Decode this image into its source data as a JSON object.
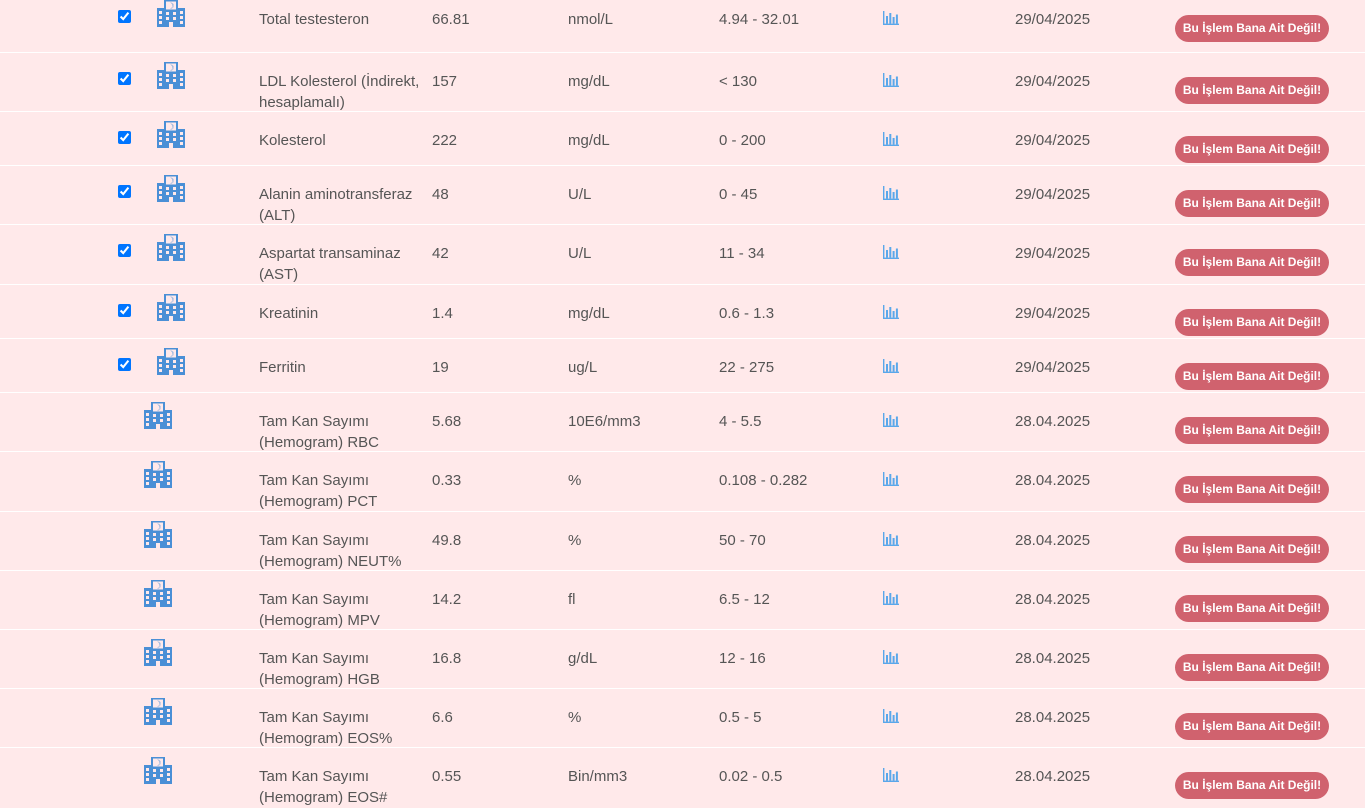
{
  "colors": {
    "row_background": "#ffe9ea",
    "row_divider": "#ffffff",
    "button_background": "#d0626e",
    "button_text": "#ffffff",
    "icon_blue": "#4a8fd6",
    "chart_icon_blue": "#5aa7ea"
  },
  "icons": {
    "checkbox": "checked-checkbox",
    "facility": "hospital-building-icon",
    "chart": "bar-chart-icon"
  },
  "results": [
    {
      "checked": true,
      "name": "Total testesteron",
      "value": "66.81",
      "unit": "nmol/L",
      "reference": "4.94 - 32.01",
      "date": "29/04/2025",
      "action_label": "Bu İşlem Bana Ait Değil!"
    },
    {
      "checked": true,
      "name": "LDL Kolesterol (İndirekt, hesaplamalı)",
      "value": "157",
      "unit": "mg/dL",
      "reference": "< 130",
      "date": "29/04/2025",
      "action_label": "Bu İşlem Bana Ait Değil!"
    },
    {
      "checked": true,
      "name": "Kolesterol",
      "value": "222",
      "unit": "mg/dL",
      "reference": "0 - 200",
      "date": "29/04/2025",
      "action_label": "Bu İşlem Bana Ait Değil!"
    },
    {
      "checked": true,
      "name": "Alanin aminotransferaz (ALT)",
      "value": "48",
      "unit": "U/L",
      "reference": "0 - 45",
      "date": "29/04/2025",
      "action_label": "Bu İşlem Bana Ait Değil!"
    },
    {
      "checked": true,
      "name": "Aspartat transaminaz (AST)",
      "value": "42",
      "unit": "U/L",
      "reference": "11 - 34",
      "date": "29/04/2025",
      "action_label": "Bu İşlem Bana Ait Değil!"
    },
    {
      "checked": true,
      "name": "Kreatinin",
      "value": "1.4",
      "unit": "mg/dL",
      "reference": "0.6 - 1.3",
      "date": "29/04/2025",
      "action_label": "Bu İşlem Bana Ait Değil!"
    },
    {
      "checked": true,
      "name": "Ferritin",
      "value": "19",
      "unit": "ug/L",
      "reference": "22 - 275",
      "date": "29/04/2025",
      "action_label": "Bu İşlem Bana Ait Değil!"
    },
    {
      "checked": false,
      "name": "Tam Kan Sayımı (Hemogram) RBC",
      "value": "5.68",
      "unit": "10E6/mm3",
      "reference": "4 - 5.5",
      "date": "28.04.2025",
      "action_label": "Bu İşlem Bana Ait Değil!"
    },
    {
      "checked": false,
      "name": "Tam Kan Sayımı (Hemogram) PCT",
      "value": "0.33",
      "unit": "%",
      "reference": "0.108 - 0.282",
      "date": "28.04.2025",
      "action_label": "Bu İşlem Bana Ait Değil!"
    },
    {
      "checked": false,
      "name": "Tam Kan Sayımı (Hemogram) NEUT%",
      "value": "49.8",
      "unit": "%",
      "reference": "50 - 70",
      "date": "28.04.2025",
      "action_label": "Bu İşlem Bana Ait Değil!"
    },
    {
      "checked": false,
      "name": "Tam Kan Sayımı (Hemogram) MPV",
      "value": "14.2",
      "unit": "fl",
      "reference": "6.5 - 12",
      "date": "28.04.2025",
      "action_label": "Bu İşlem Bana Ait Değil!"
    },
    {
      "checked": false,
      "name": "Tam Kan Sayımı (Hemogram) HGB",
      "value": "16.8",
      "unit": "g/dL",
      "reference": "12 - 16",
      "date": "28.04.2025",
      "action_label": "Bu İşlem Bana Ait Değil!"
    },
    {
      "checked": false,
      "name": "Tam Kan Sayımı (Hemogram) EOS%",
      "value": "6.6",
      "unit": "%",
      "reference": "0.5 - 5",
      "date": "28.04.2025",
      "action_label": "Bu İşlem Bana Ait Değil!"
    },
    {
      "checked": false,
      "name": "Tam Kan Sayımı (Hemogram) EOS#",
      "value": "0.55",
      "unit": "Bin/mm3",
      "reference": "0.02 - 0.5",
      "date": "28.04.2025",
      "action_label": "Bu İşlem Bana Ait Değil!"
    }
  ]
}
